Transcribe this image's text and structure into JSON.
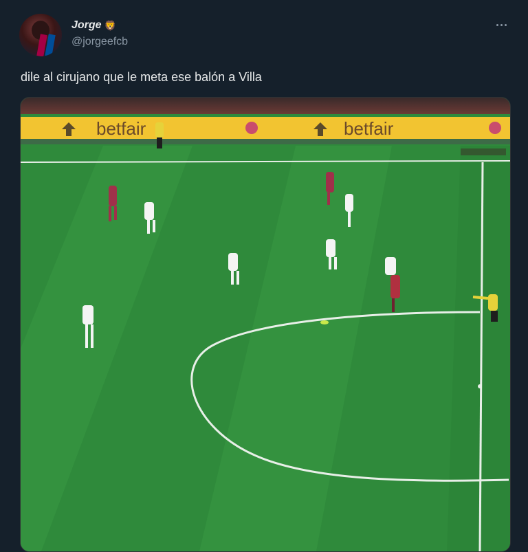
{
  "tweet": {
    "author": {
      "display_name": "Jorge",
      "badge_icon": "lion-face-icon",
      "handle": "@jorgeefcb"
    },
    "text": "dile al cirujano que le meta ese balón a Villa",
    "more_icon": "more-horizontal-icon"
  },
  "media": {
    "type": "video-still",
    "ad_board": {
      "text": "betfair",
      "color": "#f6d02f"
    },
    "colors": {
      "pitch": "#2f8a3b",
      "lines": "#f2f2f2"
    }
  }
}
